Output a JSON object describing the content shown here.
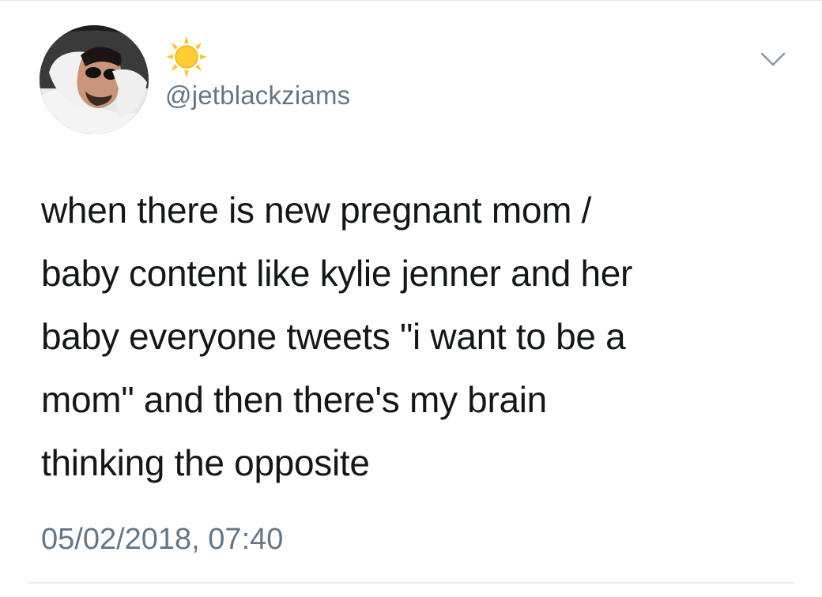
{
  "tweet": {
    "handle": "@jetblackziams",
    "display_name_emoji": "sun-emoji",
    "body_lines": [
      "when there is new pregnant mom /",
      "baby content like kylie jenner and her",
      "baby everyone tweets \"i want to be a",
      "mom\" and then there's my brain",
      "thinking the opposite"
    ],
    "timestamp": "05/02/2018, 07:40"
  },
  "icons": {
    "avatar": "profile-photo",
    "display_name": "sun-emoji",
    "menu": "chevron-down-icon"
  },
  "colors": {
    "body_text": "#14171a",
    "secondary_text": "#657786",
    "divider": "#e6ecf0",
    "sun": "#f7c531",
    "sun_center": "#ffcc33"
  }
}
